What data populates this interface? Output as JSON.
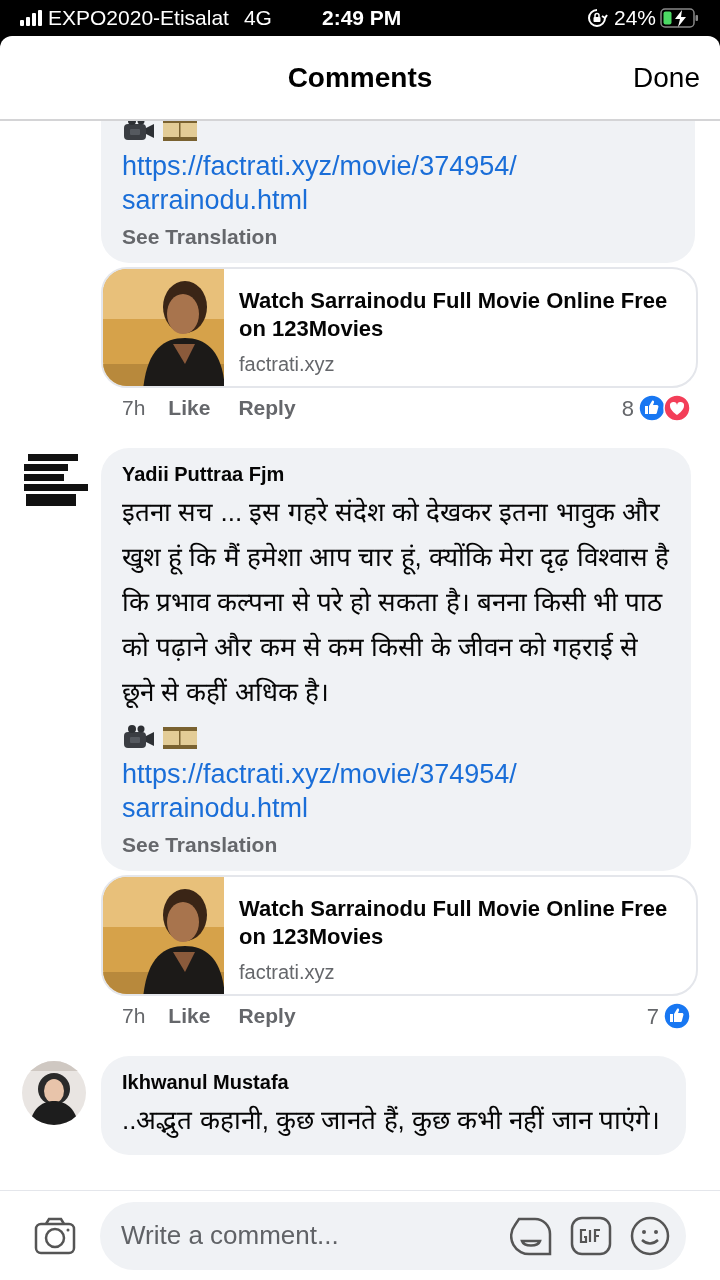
{
  "status_bar": {
    "carrier": "EXPO2020-Etisalat",
    "network": "4G",
    "time": "2:49 PM",
    "battery": "24%"
  },
  "header": {
    "title": "Comments",
    "done": "Done"
  },
  "comments": [
    {
      "emoji": true,
      "link": "https://factrati.xyz/movie/374954/sarrainodu.html",
      "see_translation": "See Translation",
      "preview": {
        "title": "Watch Sarrainodu Full Movie Online Free on 123Movies",
        "domain": "factrati.xyz"
      },
      "time": "7h",
      "like": "Like",
      "reply": "Reply",
      "reaction_count": "8",
      "reactions": [
        {
          "kind": "like"
        },
        {
          "kind": "love"
        }
      ]
    },
    {
      "author": "Yadii Puttraa Fjm",
      "avatar": {
        "kind": "badge"
      },
      "text": "इतना सच ... इस गहरे संदेश को देखकर इतना भावुक और खुश हूं कि मैं हमेशा आप चार हूं, क्योंकि मेरा दृढ़ विश्वास है कि प्रभाव कल्पना से परे हो सकता है। बनना किसी भी पाठ को पढ़ाने और कम से कम किसी के जीवन को गहराई से छूने से कहीं अधिक है।",
      "emoji": true,
      "link": "https://factrati.xyz/movie/374954/sarrainodu.html",
      "see_translation": "See Translation",
      "preview": {
        "title": "Watch Sarrainodu Full Movie Online Free on 123Movies",
        "domain": "factrati.xyz"
      },
      "time": "7h",
      "like": "Like",
      "reply": "Reply",
      "reaction_count": "7",
      "reactions": [
        {
          "kind": "like"
        }
      ]
    },
    {
      "author": "Ikhwanul Mustafa",
      "avatar": {
        "kind": "person"
      },
      "text": "..अद्भुत कहानी, कुछ जानते हैं, कुछ कभी नहीं जान पाएंगे।"
    }
  ],
  "composer": {
    "placeholder": "Write a comment..."
  }
}
